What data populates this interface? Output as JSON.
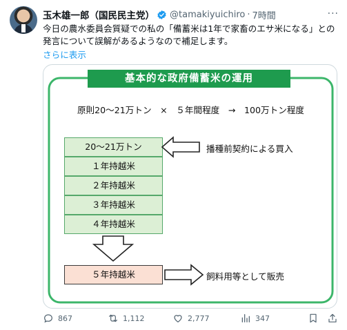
{
  "post": {
    "author_name": "玉木雄一郎（国民民主党）",
    "handle": "@tamakiyuichiro",
    "separator": "·",
    "time": "7時間",
    "more_label": "···",
    "text_line1": "今日の農水委員会質疑での私の「備蓄米は1年で家畜のエサ米になる」との",
    "text_line2": "発言について誤解があるようなので補足します。",
    "show_more": "さらに表示"
  },
  "figure": {
    "title": "基本的な政府備蓄米の運用",
    "rule": "原則20～21万トン　×　５年間程度　→　100万トン程度",
    "stock_rows": [
      "20～21万トン",
      "１年持越米",
      "２年持越米",
      "３年持越米",
      "４年持越米"
    ],
    "final_row": "５年持越米",
    "buy_label": "播種前契約による買入",
    "sell_label": "飼料用等として販売"
  },
  "actions": {
    "replies": "867",
    "reposts": "1,112",
    "likes": "2,777",
    "views": "347"
  },
  "colors": {
    "title_green": "#1e9b4e",
    "frame_green": "#3cb66a",
    "cell_green": "#dcefd5",
    "cell_pink": "#fbe0d4",
    "link_blue": "#1d9bf0",
    "verified_blue": "#1d9bf0"
  }
}
